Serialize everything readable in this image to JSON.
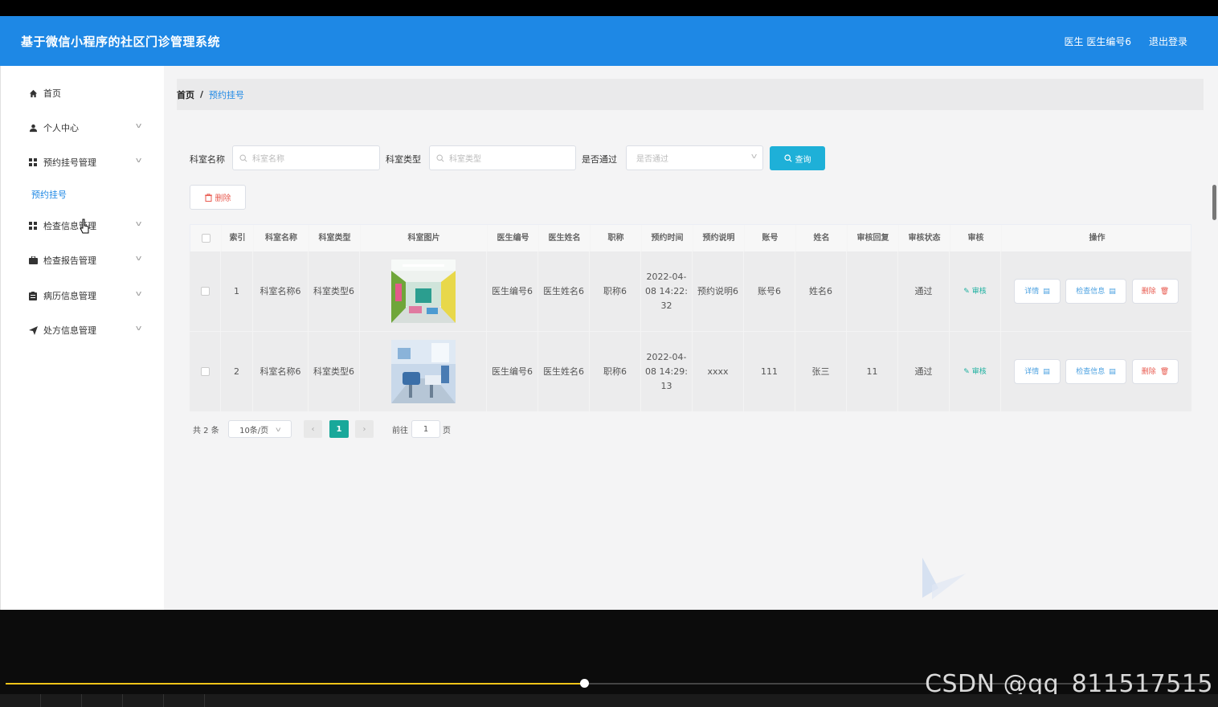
{
  "header": {
    "title": "基于微信小程序的社区门诊管理系统",
    "user": "医生 医生编号6",
    "logout": "退出登录"
  },
  "sidebar": {
    "items": [
      {
        "label": "首页",
        "icon": "home-icon",
        "expandable": false
      },
      {
        "label": "个人中心",
        "icon": "user-icon",
        "expandable": true
      },
      {
        "label": "预约挂号管理",
        "icon": "grid-icon",
        "expandable": true
      },
      {
        "label": "检查信息管理",
        "icon": "grid-icon",
        "expandable": true
      },
      {
        "label": "检查报告管理",
        "icon": "briefcase-icon",
        "expandable": true
      },
      {
        "label": "病历信息管理",
        "icon": "clipboard-icon",
        "expandable": true
      },
      {
        "label": "处方信息管理",
        "icon": "send-icon",
        "expandable": true
      }
    ],
    "sub_item": "预约挂号"
  },
  "breadcrumb": {
    "home": "首页",
    "separator": "/",
    "current": "预约挂号"
  },
  "filters": {
    "dept_name_label": "科室名称",
    "dept_name_placeholder": "科室名称",
    "dept_type_label": "科室类型",
    "dept_type_placeholder": "科室类型",
    "passed_label": "是否通过",
    "passed_placeholder": "是否通过",
    "query": "查询"
  },
  "toolbar": {
    "delete": "删除"
  },
  "table": {
    "columns": [
      "索引",
      "科室名称",
      "科室类型",
      "科室图片",
      "医生编号",
      "医生姓名",
      "职称",
      "预约时间",
      "预约说明",
      "账号",
      "姓名",
      "审核回复",
      "审核状态",
      "审核",
      "操作"
    ],
    "rows": [
      {
        "index": "1",
        "dept_name": "科室名称6",
        "dept_type": "科室类型6",
        "image": "clinic-lobby-image",
        "doctor_no": "医生编号6",
        "doctor_name": "医生姓名6",
        "title": "职称6",
        "time": "2022-04-08 14:22:32",
        "note": "预约说明6",
        "account": "账号6",
        "name": "姓名6",
        "reply": "",
        "status": "通过",
        "audit": "审核"
      },
      {
        "index": "2",
        "dept_name": "科室名称6",
        "dept_type": "科室类型6",
        "image": "dental-clinic-image",
        "doctor_no": "医生编号6",
        "doctor_name": "医生姓名6",
        "title": "职称6",
        "time": "2022-04-08 14:29:13",
        "note": "xxxx",
        "account": "111",
        "name": "张三",
        "reply": "11",
        "status": "通过",
        "audit": "审核"
      }
    ],
    "actions": {
      "detail": "详情",
      "check_info": "检查信息",
      "delete": "删除"
    }
  },
  "pagination": {
    "total": "共 2 条",
    "page_size": "10条/页",
    "current_page": "1",
    "goto_label": "前往",
    "goto_value": "1",
    "page_unit": "页"
  },
  "video": {
    "progress": 0.48,
    "watermark": "CSDN @qq_811517515"
  },
  "colors": {
    "primary": "#1e88e5",
    "accent": "#1eb0d8",
    "danger": "#e85a4f",
    "pager_active": "#19a89a"
  }
}
